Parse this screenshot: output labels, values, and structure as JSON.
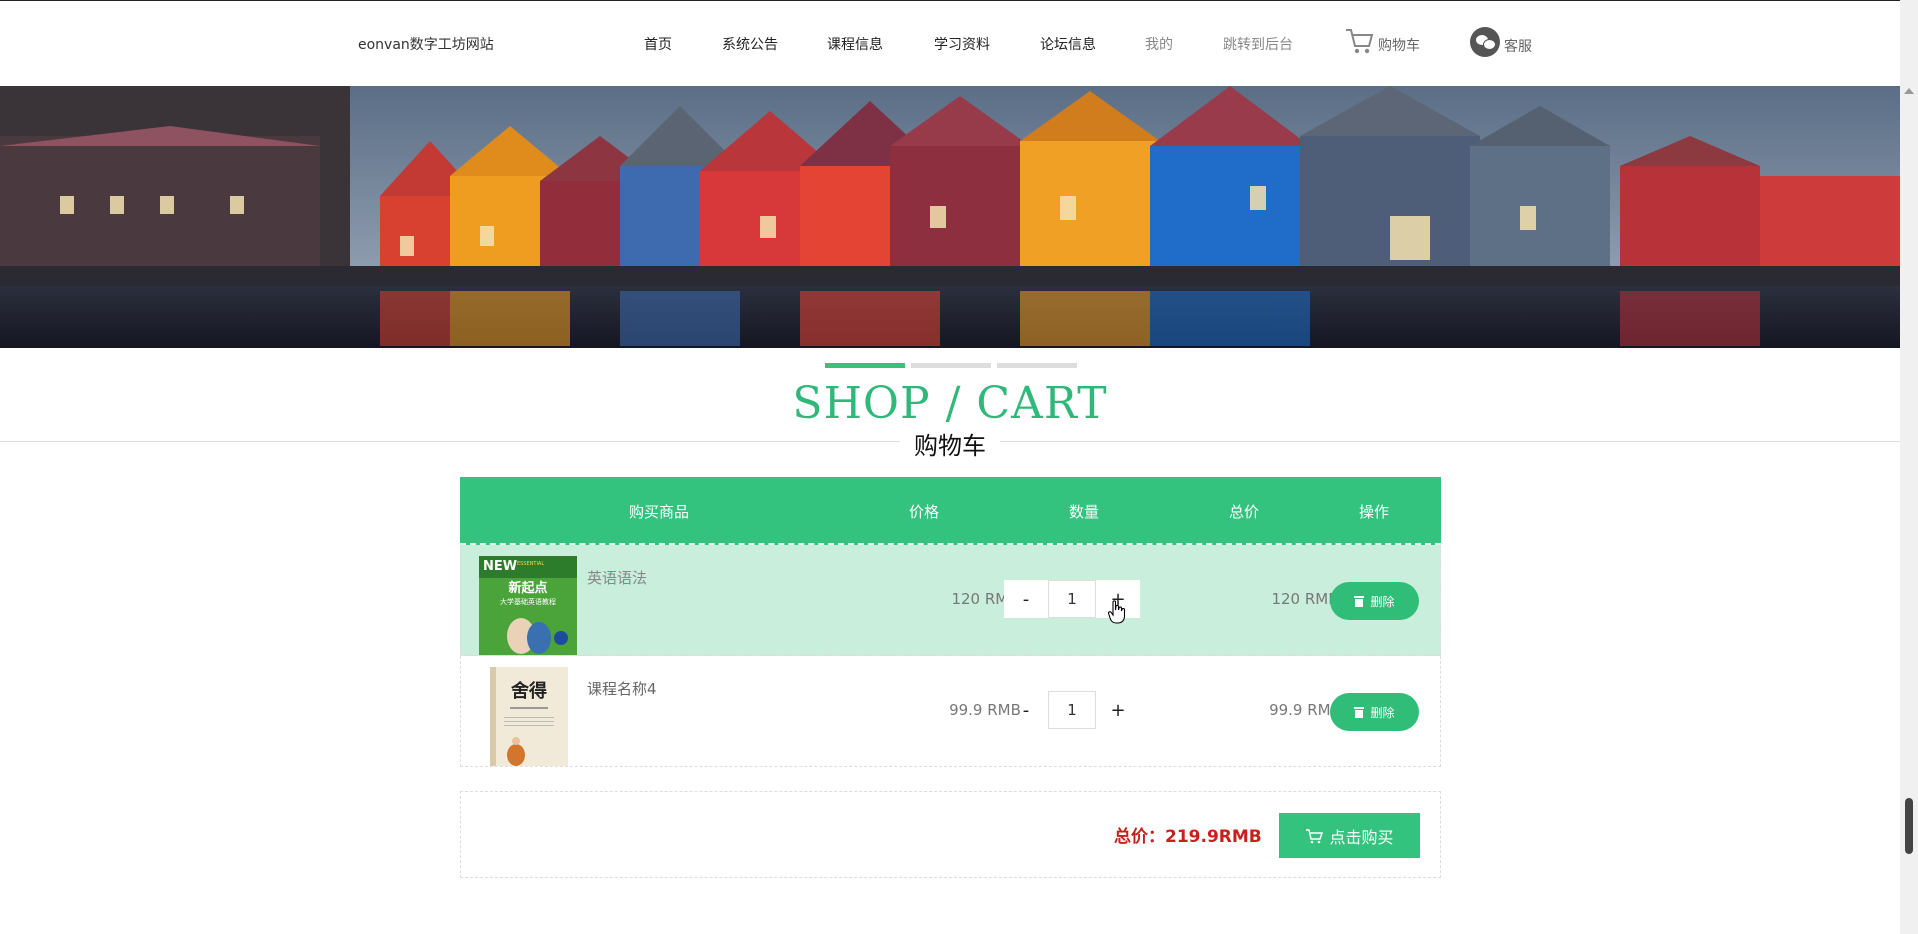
{
  "header": {
    "brand": "eonvan数字工坊网站",
    "nav": [
      {
        "label": "首页"
      },
      {
        "label": "系统公告"
      },
      {
        "label": "课程信息"
      },
      {
        "label": "学习资料"
      },
      {
        "label": "论坛信息"
      },
      {
        "label": "我的"
      },
      {
        "label": "跳转到后台"
      }
    ],
    "cart_label": "购物车",
    "service_label": "客服"
  },
  "section": {
    "title_en": "SHOP / CART",
    "title_cn": "购物车"
  },
  "table": {
    "headers": [
      "购买商品",
      "价格",
      "数量",
      "总价",
      "操作"
    ],
    "rows": [
      {
        "name": "英语语法",
        "price": "120 RMB",
        "quantity": "1",
        "total": "120 RMB",
        "delete_label": "删除",
        "minus": "-",
        "plus": "+",
        "cover_text": [
          "NEW",
          "ESSENTIAL",
          "新起点",
          "大学基础英语教程"
        ]
      },
      {
        "name": "课程名称4",
        "price": "99.9 RMB",
        "quantity": "1",
        "total": "99.9 RMB",
        "delete_label": "删除",
        "minus": "-",
        "plus": "+",
        "cover_text": [
          "舍得"
        ]
      }
    ]
  },
  "summary": {
    "total_text": "总价：219.9RMB",
    "buy_label": "点击购买"
  },
  "colors": {
    "accent": "#33c37f",
    "row_highlight": "#c9eedb",
    "total_red": "#c8201a"
  }
}
